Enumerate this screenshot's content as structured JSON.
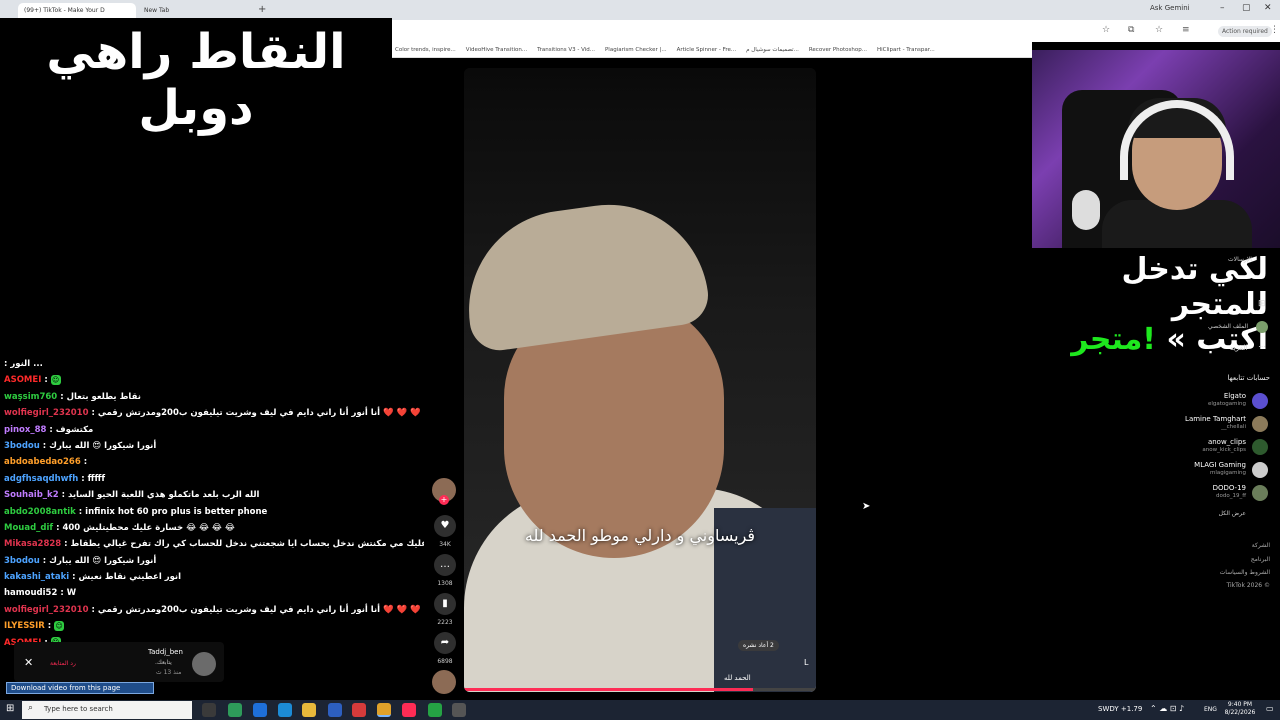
{
  "browser": {
    "tabs": [
      {
        "label": "(99+) TikTok - Make Your D"
      },
      {
        "label": "New Tab"
      }
    ],
    "new_tab_symbol": "+",
    "ask_gemini": "Ask Gemini",
    "action_required": "Action required",
    "bookmarks": [
      "Color trends, inspire...",
      "VideoHive Transition...",
      "Transitions V3 - Vid...",
      "Plagiarism Checker |...",
      "Article Spinner - Fre...",
      "تصميمات سوشيال م...",
      "Recover Photoshop...",
      "HiClipart - Transpar..."
    ]
  },
  "overlay": {
    "title": "النقاط راهي دوبل",
    "promo_line1": "لكي تدخل للمتجر",
    "promo_line2_white": "اكتب »",
    "promo_line2_green": "!متجر"
  },
  "video": {
    "caption": "ڨريساوني و دارلي موطو الحمد لله",
    "footer_text": "الحمد لله",
    "corner_letter": "L",
    "chip_text": "2 أعاد نشره",
    "progress": 0.82
  },
  "rail": {
    "like_count": "34K",
    "comment_count": "1308",
    "save_count": "2223",
    "share_count": "6898",
    "follow_symbol": "+"
  },
  "chat": [
    {
      "user": "",
      "text": "النور ... ",
      "color": "#4da3ff"
    },
    {
      "user": "ASOMEI",
      "text": "",
      "color": "#ff2a2a",
      "badge": true
    },
    {
      "user": "waşsim760",
      "text": "نقاط يطلعو بتعال",
      "color": "#2ecc40"
    },
    {
      "user": "wolfiegirl_232010",
      "text": "أنا أنور أنا راني دايم في ليف وشريت تيليفون ب200ومدرتش رقمي ❤️ ❤️ ❤️",
      "color": "#e0344e"
    },
    {
      "user": "pinox_88",
      "text": "مكتشوف",
      "color": "#c07cff"
    },
    {
      "user": "3bodou",
      "text": "أنورا شيكورا 😍 الله يبارك",
      "color": "#4da3ff"
    },
    {
      "user": "abdoabedao266",
      "text": "",
      "color": "#ff9f2a"
    },
    {
      "user": "adgfhsaqdhwfh",
      "text": "fffff",
      "color": "#4da3ff"
    },
    {
      "user": "Souhaib_k2",
      "text": "الله الرب بلعد ماتكملو هذي اللعبة الحيو السايد",
      "color": "#c07cff"
    },
    {
      "user": "abdo2008antik",
      "text": "infinix hot 60 pro plus is better phone",
      "color": "#2ecc40"
    },
    {
      "user": "Mouad_dif",
      "text": "400 خسارة عليك محطيتليش 😂 😂 😂 😂",
      "color": "#2ecc40"
    },
    {
      "user": "Mikasa2828",
      "text": "ديما تتفرج عليك مي مكنتش ندخل بحساب ايا شجعتني ندخل للحساب كي راك تفرح غيالي يطقاط!",
      "color": "#e0344e"
    },
    {
      "user": "3bodou",
      "text": "أنورا شيكورا 😍 الله يبارك",
      "color": "#4da3ff"
    },
    {
      "user": "kakashi_ataki",
      "text": "انور اعطيني نقاط نعيش",
      "color": "#4da3ff"
    },
    {
      "user": "hamoudi52",
      "text": "W",
      "color": "#fff"
    },
    {
      "user": "wolfiegirl_232010",
      "text": "أنا أنور أنا راني دايم في ليف وشريت تيليفون ب200ومدرتش رقمي ❤️ ❤️ ❤️",
      "color": "#e0344e"
    },
    {
      "user": "ILYESSIR",
      "text": "",
      "color": "#ff9f2a",
      "badge": true
    },
    {
      "user": "ASOMEI",
      "text": "",
      "color": "#ff2a2a",
      "badge": true
    }
  ],
  "notification": {
    "name": "Taddj_ben",
    "subtitle": "يتابعك.",
    "time": "منذ 13 ث",
    "reply": "رد المتابعة",
    "close_symbol": "✕"
  },
  "download_bar": "Download video from this page",
  "sidebar": {
    "top_small": "الإرسالات",
    "profile_label": "الملف الشخصي",
    "more": "المزيد",
    "following_title": "حسابات تتابعها",
    "accounts": [
      {
        "name": "Elgato",
        "handle": "elgatogaming"
      },
      {
        "name": "Lamine Tamghart",
        "handle": "__chellali"
      },
      {
        "name": "anow_clips",
        "handle": "anow_kick_clips"
      },
      {
        "name": "MLAGI Gaming",
        "handle": "mlagigaming"
      },
      {
        "name": "DODO-19",
        "handle": "dodo_19_ff"
      }
    ],
    "see_all": "عرض الكل",
    "footer": [
      "الشركة",
      "البرنامج",
      "الشروط والسياسات",
      "TikTok 2026 ©"
    ]
  },
  "taskbar": {
    "search_placeholder": "Type here to search",
    "weather": "SWDY  +1.79",
    "lang": "ENG",
    "time": "9:40 PM",
    "date": "8/22/2026"
  }
}
